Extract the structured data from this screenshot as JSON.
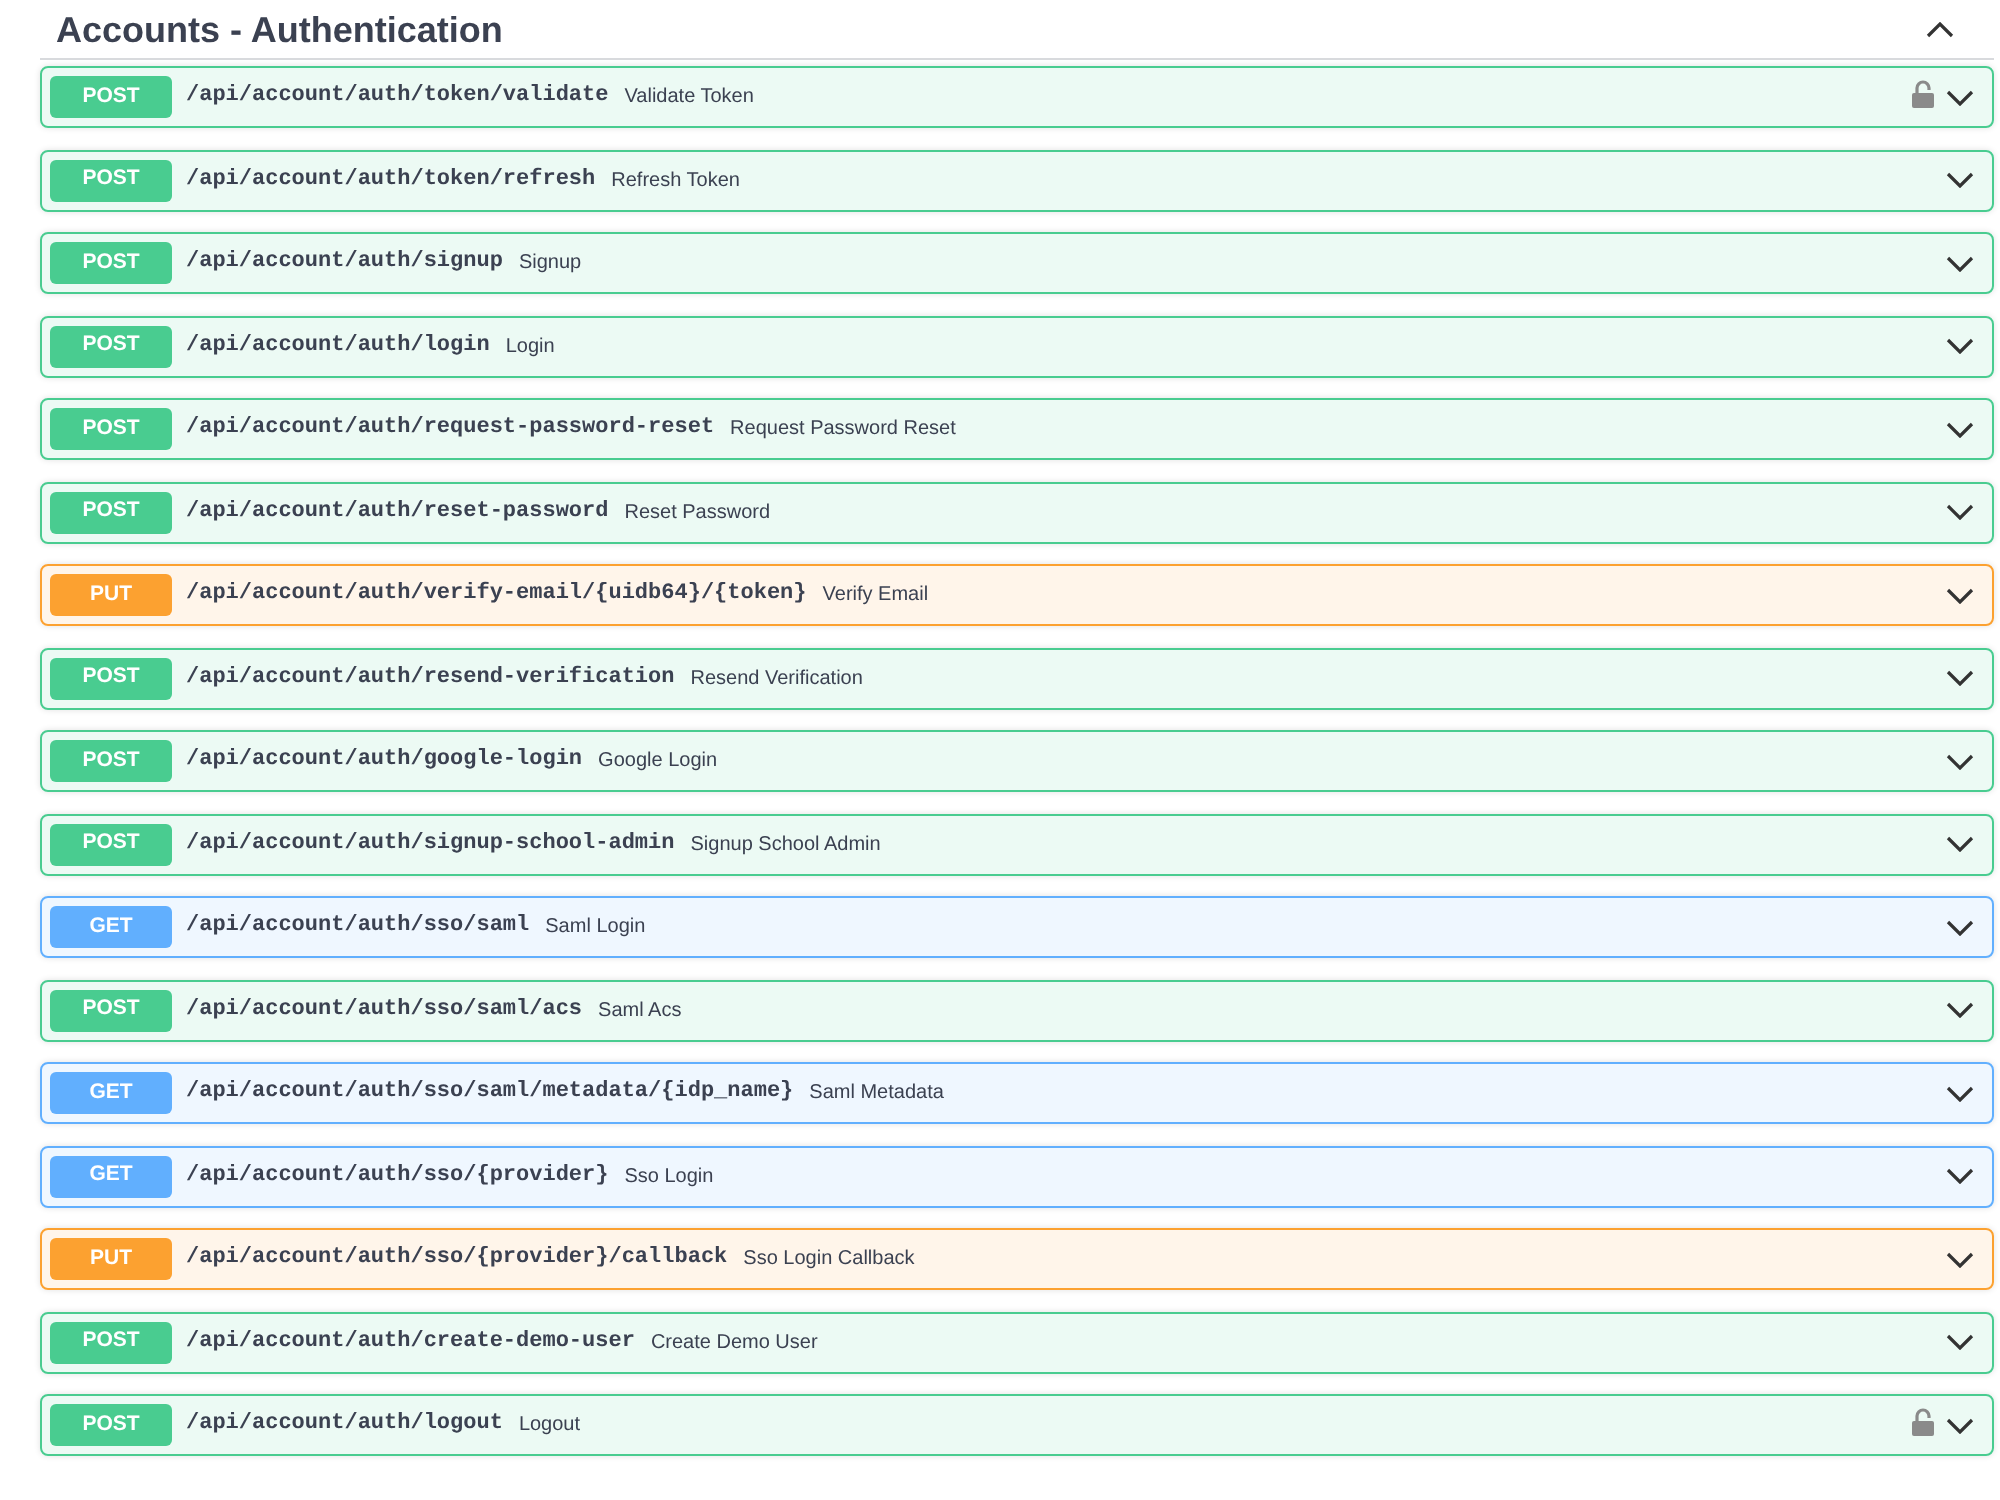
{
  "section": {
    "title": "Accounts - Authentication",
    "expanded": true
  },
  "operations": [
    {
      "method": "POST",
      "color": "#49cc90",
      "path": "/api/account/auth/token/validate",
      "summary": "Validate Token",
      "lock": true,
      "expanded": false
    },
    {
      "method": "POST",
      "color": "#49cc90",
      "path": "/api/account/auth/token/refresh",
      "summary": "Refresh Token",
      "lock": false,
      "expanded": false
    },
    {
      "method": "POST",
      "color": "#49cc90",
      "path": "/api/account/auth/signup",
      "summary": "Signup",
      "lock": false,
      "expanded": false
    },
    {
      "method": "POST",
      "color": "#49cc90",
      "path": "/api/account/auth/login",
      "summary": "Login",
      "lock": false,
      "expanded": false
    },
    {
      "method": "POST",
      "color": "#49cc90",
      "path": "/api/account/auth/request-password-reset",
      "summary": "Request Password Reset",
      "lock": false,
      "expanded": false
    },
    {
      "method": "POST",
      "color": "#49cc90",
      "path": "/api/account/auth/reset-password",
      "summary": "Reset Password",
      "lock": false,
      "expanded": false
    },
    {
      "method": "PUT",
      "color": "#fca130",
      "path": "/api/account/auth/verify-email/{uidb64}/{token}",
      "summary": "Verify Email",
      "lock": false,
      "expanded": false
    },
    {
      "method": "POST",
      "color": "#49cc90",
      "path": "/api/account/auth/resend-verification",
      "summary": "Resend Verification",
      "lock": false,
      "expanded": false
    },
    {
      "method": "POST",
      "color": "#49cc90",
      "path": "/api/account/auth/google-login",
      "summary": "Google Login",
      "lock": false,
      "expanded": false
    },
    {
      "method": "POST",
      "color": "#49cc90",
      "path": "/api/account/auth/signup-school-admin",
      "summary": "Signup School Admin",
      "lock": false,
      "expanded": false
    },
    {
      "method": "GET",
      "color": "#61affe",
      "path": "/api/account/auth/sso/saml",
      "summary": "Saml Login",
      "lock": false,
      "expanded": false
    },
    {
      "method": "POST",
      "color": "#49cc90",
      "path": "/api/account/auth/sso/saml/acs",
      "summary": "Saml Acs",
      "lock": false,
      "expanded": false
    },
    {
      "method": "GET",
      "color": "#61affe",
      "path": "/api/account/auth/sso/saml/metadata/{idp_name}",
      "summary": "Saml Metadata",
      "lock": false,
      "expanded": false
    },
    {
      "method": "GET",
      "color": "#61affe",
      "path": "/api/account/auth/sso/{provider}",
      "summary": "Sso Login",
      "lock": false,
      "expanded": false
    },
    {
      "method": "PUT",
      "color": "#fca130",
      "path": "/api/account/auth/sso/{provider}/callback",
      "summary": "Sso Login Callback",
      "lock": false,
      "expanded": false
    },
    {
      "method": "POST",
      "color": "#49cc90",
      "path": "/api/account/auth/create-demo-user",
      "summary": "Create Demo User",
      "lock": false,
      "expanded": false
    },
    {
      "method": "POST",
      "color": "#49cc90",
      "path": "/api/account/auth/logout",
      "summary": "Logout",
      "lock": true,
      "expanded": false
    }
  ]
}
